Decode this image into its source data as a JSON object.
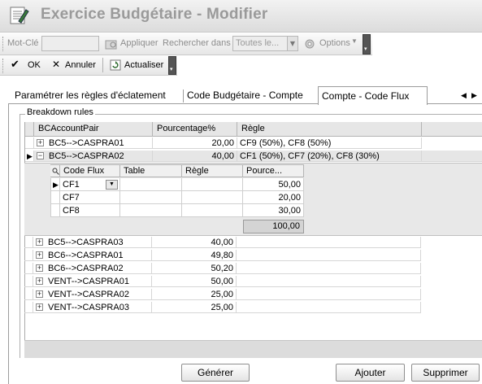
{
  "window": {
    "title": "Exercice Budgétaire - Modifier"
  },
  "search_toolbar": {
    "keyword_label": "Mot-Clé",
    "keyword_value": "",
    "apply_label": "Appliquer",
    "search_in_label": "Rechercher dans",
    "search_in_value": "Toutes le...",
    "options_label": "Options"
  },
  "action_toolbar": {
    "ok_label": "OK",
    "cancel_label": "Annuler",
    "refresh_label": "Actualiser"
  },
  "tabs": [
    {
      "label": "Paramétrer les règles d'éclatement"
    },
    {
      "label": "Code Budgétaire - Compte"
    },
    {
      "label": "Compte - Code Flux"
    }
  ],
  "group": {
    "label": "Breakdown rules"
  },
  "grid": {
    "columns": [
      "BCAccountPair",
      "Pourcentage%",
      "Règle"
    ],
    "rows": [
      {
        "pair": "BC5-->CASPRA01",
        "pct": "20,00",
        "rule": "CF9 (50%), CF8 (50%)",
        "expanded": false
      },
      {
        "pair": "BC5-->CASPRA02",
        "pct": "40,00",
        "rule": "CF1 (50%), CF7 (20%), CF8 (30%)",
        "expanded": true
      },
      {
        "pair": "BC5-->CASPRA03",
        "pct": "40,00",
        "rule": ""
      },
      {
        "pair": "BC6-->CASPRA01",
        "pct": "49,80",
        "rule": ""
      },
      {
        "pair": "BC6-->CASPRA02",
        "pct": "50,20",
        "rule": ""
      },
      {
        "pair": "VENT-->CASPRA01",
        "pct": "50,00",
        "rule": ""
      },
      {
        "pair": "VENT-->CASPRA02",
        "pct": "25,00",
        "rule": ""
      },
      {
        "pair": "VENT-->CASPRA03",
        "pct": "25,00",
        "rule": ""
      }
    ],
    "child": {
      "columns": [
        "Code Flux",
        "Table",
        "Règle",
        "Pource..."
      ],
      "rows": [
        {
          "code": "CF1",
          "table": "",
          "rule": "",
          "pct": "50,00"
        },
        {
          "code": "CF7",
          "table": "",
          "rule": "",
          "pct": "20,00"
        },
        {
          "code": "CF8",
          "table": "",
          "rule": "",
          "pct": "30,00"
        }
      ],
      "total": "100,00"
    }
  },
  "buttons": {
    "generate": "Générer",
    "add": "Ajouter",
    "delete": "Supprimer"
  }
}
